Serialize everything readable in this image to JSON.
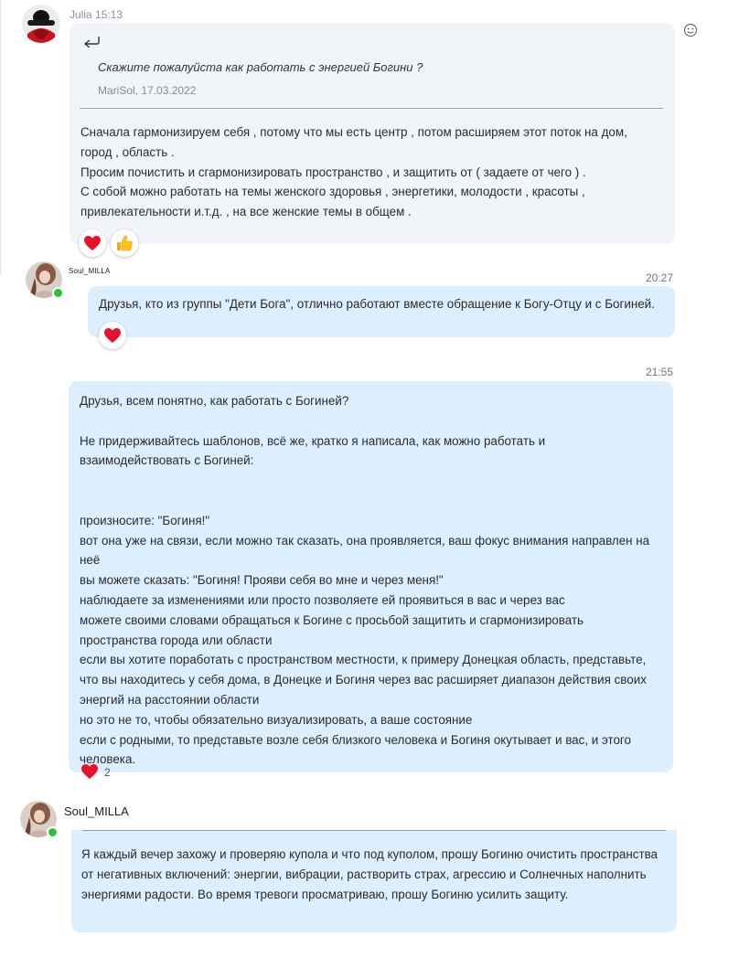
{
  "messages": [
    {
      "sender": "Julia",
      "time": "15:13",
      "quote": {
        "text": "Скажите пожалуйста как работать с энергией Богини ?",
        "author_date": "MariSol, 17.03.2022"
      },
      "text": "Сначала гармонизируем себя , потому что мы есть центр , потом расширяем этот поток на  дом, город , область .\nПросим почистить и сгармонизировать пространство , и защитить от ( задаете от чего ) .\nС собой можно работать на темы женского здоровья , энергетики,  молодости , красоты , привлекательности и.т.д. , на все женские темы в общем .",
      "reactions": [
        "heart",
        "thumbs-up"
      ]
    },
    {
      "sender": "Soul_MILLA",
      "time": "20:27",
      "text": "Друзья, кто из группы \"Дети Бога\", отлично работают вместе обращение к Богу-Отцу и с Богиней.",
      "reactions": [
        "heart"
      ]
    },
    {
      "time": "21:55",
      "text": "Друзья, всем понятно, как работать с Богиней?\n\nНе придерживайтесь шаблонов, всё же, кратко я написала, как можно работать и взаимодействовать с Богиней:\n\n\nпроизносите: \"Богиня!\"\nвот она уже на связи, если можно так сказать, она проявляется, ваш фокус внимания направлен на неё\nвы можете сказать: \"Богиня! Прояви себя во мне и через меня!\"\nнаблюдаете за изменениями или просто позволяете ей проявиться в вас и через вас\nможете своими словами обращаться к Богине с просьбой защитить и сгармонизировать пространства города или области\nесли вы хотите поработать с пространством местности, к примеру Донецкая область, представьте, что вы находитесь у себя дома, в Донецке и Богиня через вас расширяет диапазон действия своих энергий на расстоянии области\nно это не то, чтобы обязательно визуализировать, а ваше состояние\nесли с родными, то представьте возле себя близкого человека и Богиня окутывает и вас, и этого человека.",
      "reaction_count": "2"
    },
    {
      "sender": "Soul_MILLA",
      "text": "Я каждый вечер захожу и проверяю купола и что под куполом, прошу Богиню очистить пространства от негативных включений: энергии, вибрации, растворить страх, агрессию и Солнечных наполнить энергиями радости. Во время тревоги просматриваю, прошу Богиню усилить защиту."
    }
  ],
  "icons": {
    "reply": "reply-arrow-icon",
    "add_reaction": "smiley-icon",
    "heart": "heart-icon",
    "thumbs_up": "thumbs-up-icon"
  },
  "colors": {
    "grey_bubble": "#f1f4f9",
    "blue_bubble": "#dcefff",
    "online": "#2fbf3a",
    "heart": "#e8112d"
  }
}
